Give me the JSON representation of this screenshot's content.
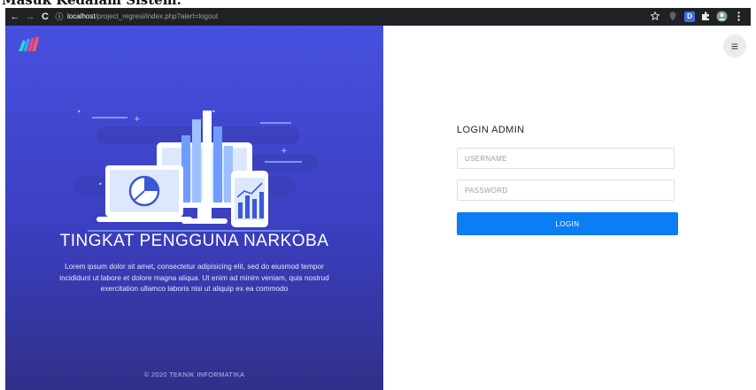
{
  "caption": "Masuk Kedalam Sistem.",
  "browser": {
    "back_glyph": "←",
    "forward_glyph": "→",
    "reload_glyph": "C",
    "info_glyph": "ⓘ",
    "url_host": "localhost",
    "url_path": "/project_regresi/index.php?alert=logout",
    "extension_d_label": "D"
  },
  "left": {
    "heading": "TINGKAT PENGGUNA NARKOBA",
    "description": "Lorem ipsum dolor sit amet, consectetur adipisicing elit, sed do eiusmod tempor incididunt ut labore et dolore magna aliqua. Ut enim ad minim veniam, quis nostrud exercitation ullamco laboris nisi ut aliquip ex ea commodo",
    "footer": "© 2020 TEKNIK INFORMATIKA",
    "logo_icon": "brand-logo-icon",
    "illustration": "analytics-devices-illustration"
  },
  "right": {
    "menu_glyph": "≡",
    "form_title": "LOGIN ADMIN",
    "username_placeholder": "USERNAME",
    "password_placeholder": "PASSWORD",
    "login_label": "LOGIN"
  },
  "colors": {
    "panel_top": "#4750df",
    "panel_bottom": "#303089",
    "button": "#0d7df5",
    "browser_bar": "#202124"
  }
}
